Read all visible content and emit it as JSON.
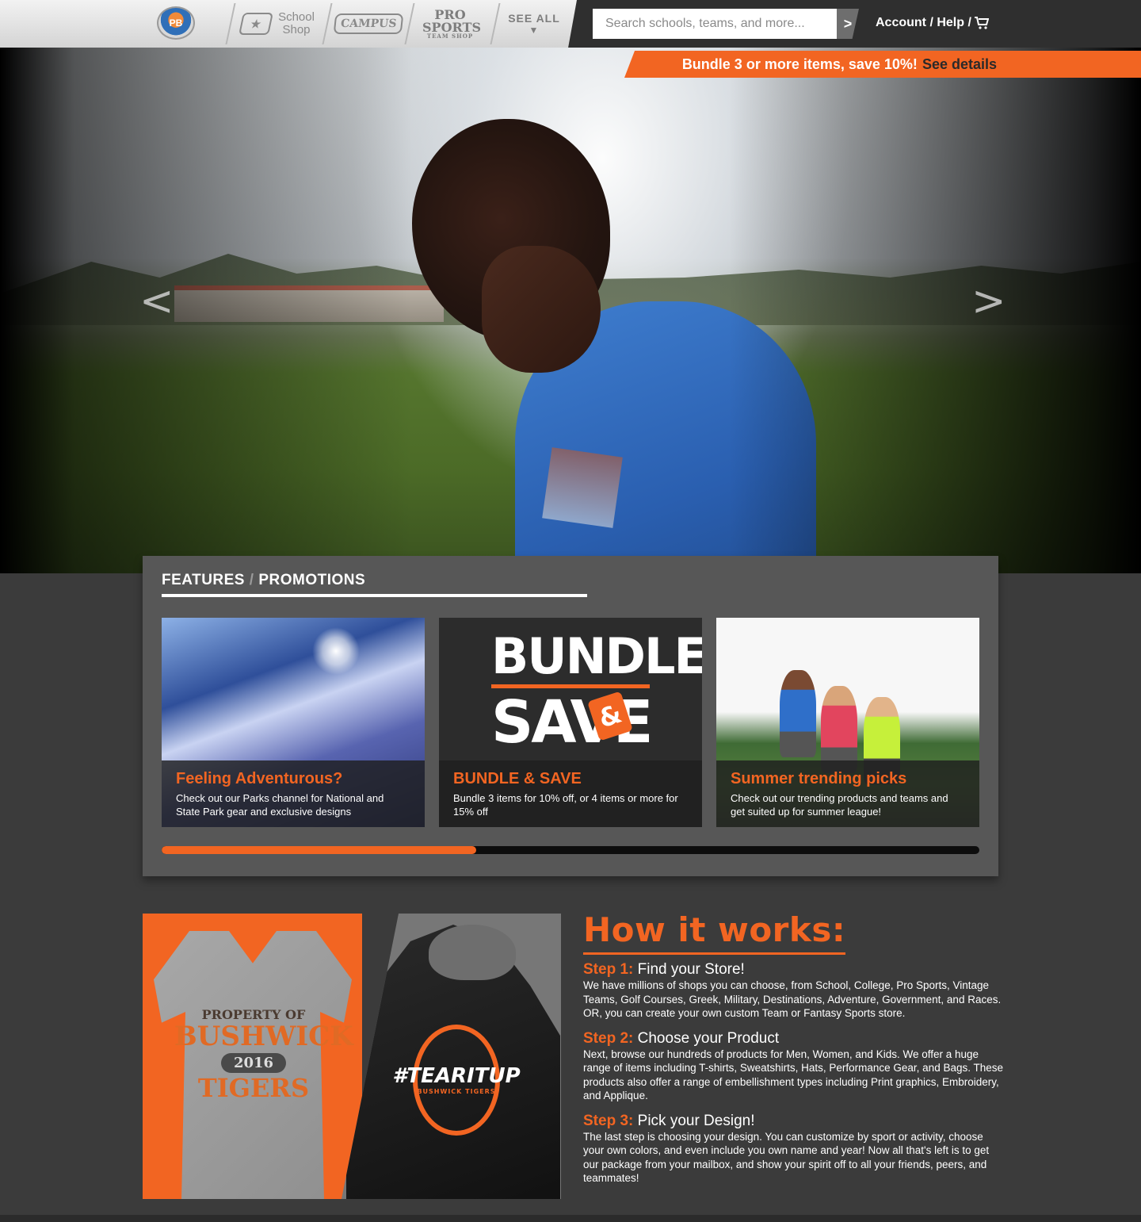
{
  "header": {
    "logo_label": "PB",
    "nav": {
      "school_shop": "School Shop",
      "school_shop_tm": "™",
      "campus": "CAMPUS",
      "pro_sports": "PRO SPORTS",
      "pro_sports_sub": "TEAM SHOP",
      "see_all": "SEE ALL",
      "see_all_arrow": "▼"
    },
    "search": {
      "placeholder": "Search schools, teams, and more...",
      "button": ">"
    },
    "account": "Account / Help /"
  },
  "promo_banner": {
    "text": "Bundle 3 or more items, save 10%!",
    "link": "See details"
  },
  "hero": {
    "prev": "<",
    "next": ">"
  },
  "features": {
    "title_left": "FEATURES",
    "title_sep": "/",
    "title_right": "PROMOTIONS",
    "cards": [
      {
        "title": "Feeling Adventurous?",
        "body": "Check out our Parks channel for National and State Park gear and exclusive designs"
      },
      {
        "title": "BUNDLE & SAVE",
        "body": "Bundle 3 items for 10% off, or 4 items or more for 15% off",
        "art_top": "BUNDLE",
        "art_amp": "&",
        "art_bottom": "SAVE"
      },
      {
        "title": "Summer trending picks",
        "body": "Check out our trending products and teams and get suited up for summer league!"
      }
    ],
    "carousel_progress": 0.385
  },
  "products": {
    "tee": {
      "line1": "PROPERTY OF",
      "line2": "BUSHWICK",
      "line3": "2016",
      "line4": "TIGERS"
    },
    "hoodie": {
      "line1": "#TEARITUP",
      "line2": "BUSHWICK TIGERS"
    }
  },
  "how_it_works": {
    "title": "How it works:",
    "steps": [
      {
        "num": "Step 1:",
        "head": "Find your Store!",
        "body": "We have millions of shops you can choose, from School, College, Pro Sports, Vintage Teams, Golf Courses, Greek, Military, Destinations, Adventure, Government, and Races. OR, you can create your own custom Team or Fantasy Sports store."
      },
      {
        "num": "Step 2:",
        "head": "Choose your Product",
        "body": "Next, browse our hundreds of products for Men, Women, and Kids. We offer a huge range of items including T-shirts, Sweatshirts, Hats, Performance Gear, and Bags. These products also offer a range of embellishment types including Print graphics, Embroidery, and Applique."
      },
      {
        "num": "Step 3:",
        "head": "Pick your Design!",
        "body": "The last step is choosing your design. You can customize by sport or activity, choose your own colors, and even include you own name and year! Now all that's left is to get our package from your mailbox, and show your spirit off to all your friends, peers, and teammates!"
      }
    ]
  },
  "colors": {
    "accent": "#f26522",
    "dark": "#3b3b3b",
    "panel": "#575757"
  }
}
